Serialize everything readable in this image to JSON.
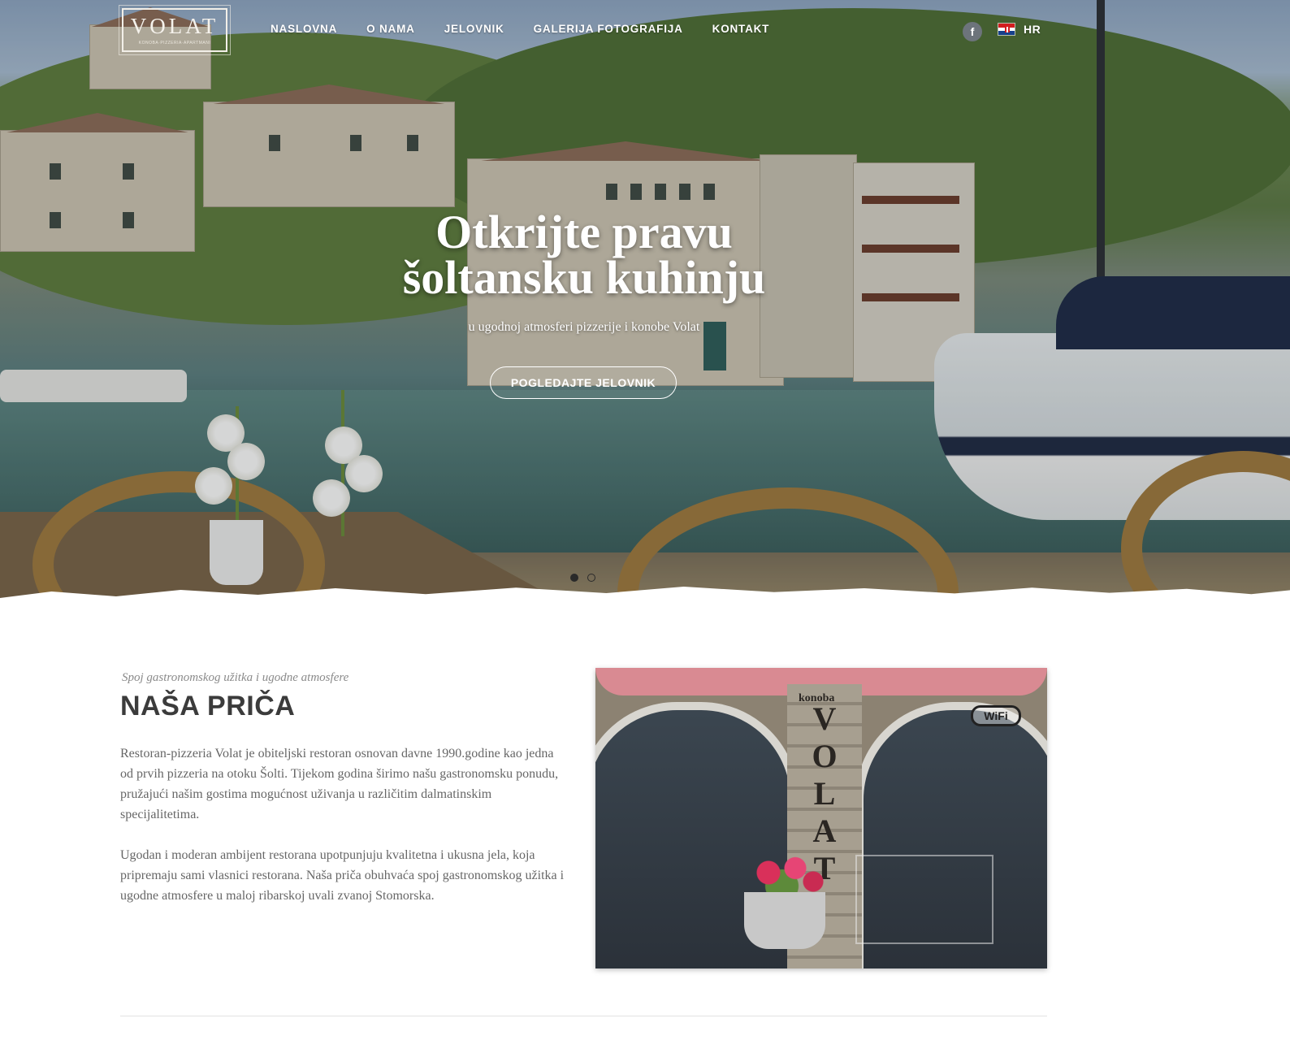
{
  "brand": {
    "name": "VOLAT",
    "tagline": "KONOBA·PIZZERIA·APARTMANI"
  },
  "nav": {
    "items": [
      "NASLOVNA",
      "O NAMA",
      "JELOVNIK",
      "GALERIJA FOTOGRAFIJA",
      "KONTAKT"
    ],
    "active_index": 0
  },
  "social": {
    "facebook_glyph": "f"
  },
  "language": {
    "code": "HR",
    "flag_icon": "croatia-flag-icon"
  },
  "hero": {
    "title_line1": "Otkrijte pravu",
    "title_line2": "šoltansku kuhinju",
    "subtitle": "u ugodnoj atmosferi pizzerije i konobe Volat",
    "cta_label": "POGLEDAJTE JELOVNIK",
    "slides_total": 2,
    "active_slide": 1
  },
  "story": {
    "kicker": "Spoj gastronomskog užitka i ugodne atmosfere",
    "heading": "NAŠA PRIČA",
    "paragraph1": "Restoran-pizzeria Volat je obiteljski restoran osnovan davne 1990.godine kao jedna od prvih pizzeria na otoku Šolti. Tijekom godina širimo našu gastronomsku ponudu, pružajući našim gostima mogućnost uživanja u različitim dalmatinskim specijalitetima.",
    "paragraph2": "Ugodan i moderan ambijent restorana upotpunjuju kvalitetna i ukusna jela, koja pripremaju sami vlasnici restorana. Naša priča obuhvaća spoj gastronomskog užitka i ugodne atmosfere u maloj ribarskoj uvali zvanoj Stomorska.",
    "photo_sign_top": "konoba",
    "photo_sign_letters": "VOLAT",
    "photo_wifi": "WiFi"
  },
  "colors": {
    "heading": "#3b3b3b",
    "body_text": "#666666",
    "kicker": "#8a8a8a"
  }
}
